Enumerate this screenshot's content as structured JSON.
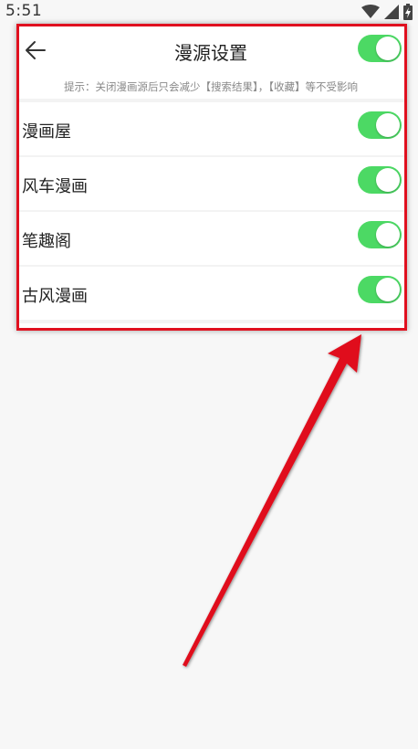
{
  "status_bar": {
    "time": "5:51",
    "icons": [
      "wifi-icon",
      "signal-icon",
      "battery-charging-icon"
    ]
  },
  "header": {
    "back_icon": "arrow-left-icon",
    "title": "漫源设置",
    "master_toggle_on": true
  },
  "hint": "提示：关闭漫画源后只会减少【搜索结果】，【收藏】等不受影响",
  "sources": [
    {
      "label": "漫画屋",
      "enabled": true
    },
    {
      "label": "风车漫画",
      "enabled": true
    },
    {
      "label": "笔趣阁",
      "enabled": true
    },
    {
      "label": "古风漫画",
      "enabled": true
    }
  ],
  "colors": {
    "toggle_on": "#4cd964",
    "highlight": "#e0101f",
    "background": "#f7f7f7"
  }
}
